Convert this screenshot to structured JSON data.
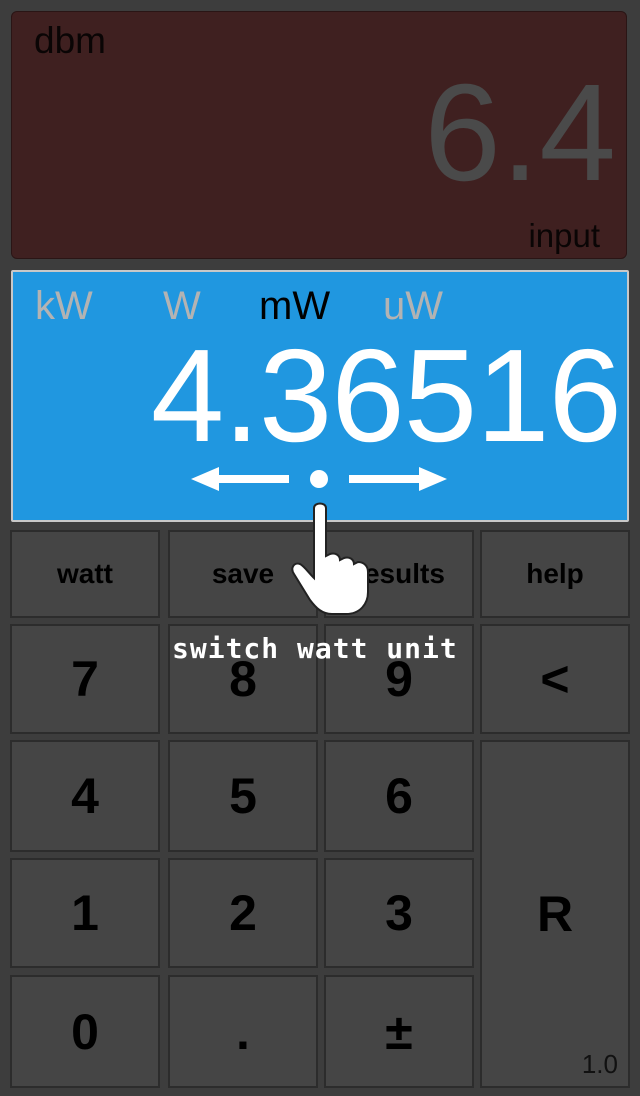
{
  "input_panel": {
    "unit": "dbm",
    "value": "6.4",
    "caption": "input"
  },
  "output_panel": {
    "units": [
      "kW",
      "W",
      "mW",
      "uW"
    ],
    "active_unit": "mW",
    "value": "4.36516"
  },
  "keypad": {
    "top_row": [
      "watt",
      "save",
      "results",
      "help"
    ],
    "row1": [
      "7",
      "8",
      "9",
      "<"
    ],
    "row2": [
      "4",
      "5",
      "6"
    ],
    "row3": [
      "1",
      "2",
      "3"
    ],
    "row4": [
      "0",
      ".",
      "±"
    ],
    "recalc": "R",
    "version": "1.0"
  },
  "tutorial": {
    "hint": "switch watt unit"
  },
  "colors": {
    "background": "#3d3d3d",
    "input_panel": "#3f2020",
    "output_panel": "#2097e0",
    "key": "#454545"
  }
}
